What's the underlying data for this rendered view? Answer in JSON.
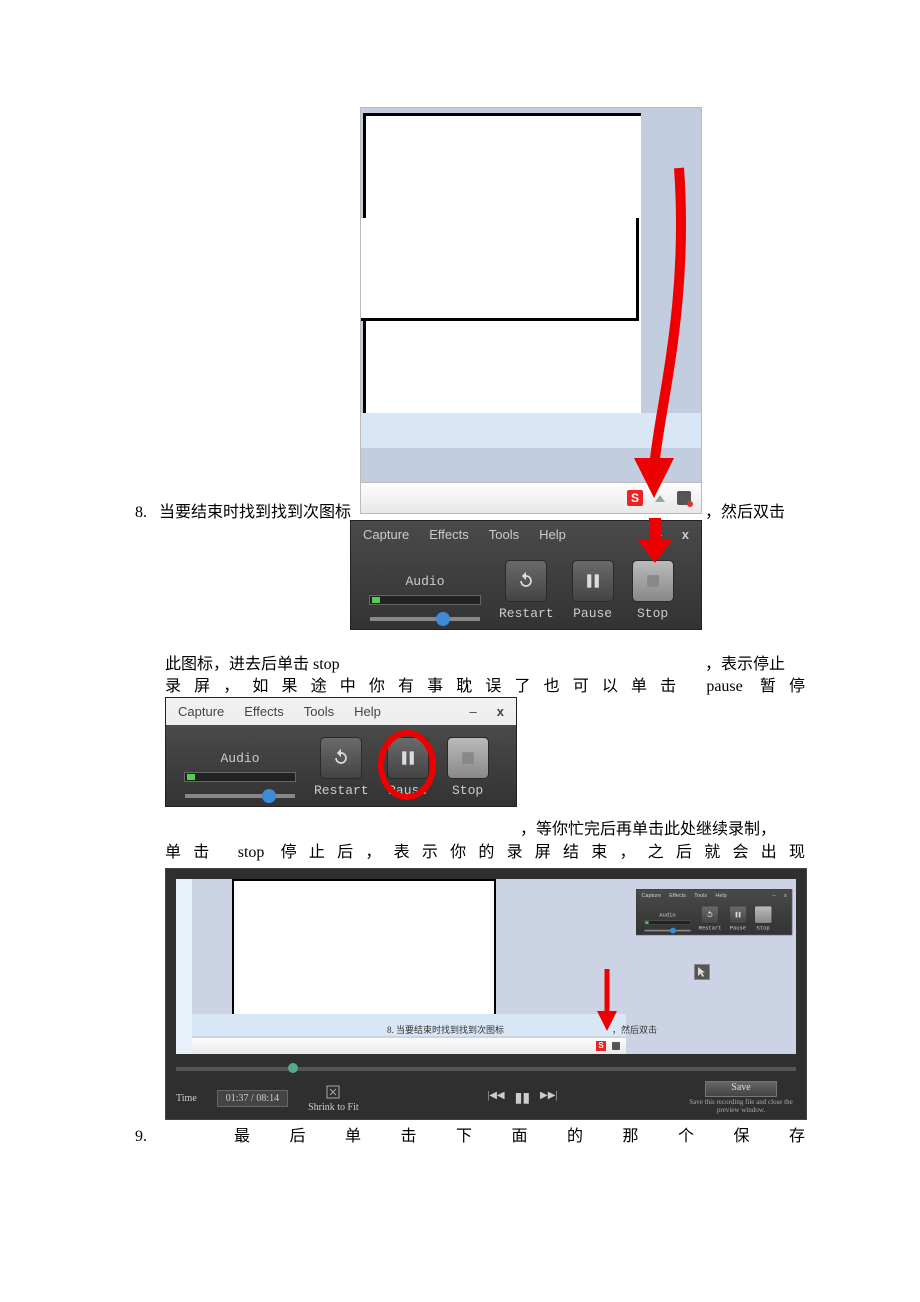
{
  "steps": {
    "s8": {
      "num": "8.",
      "text_a": "当要结束时找到找到次图标",
      "text_b": "，然后双击",
      "text_c": "此图标，进去后单击 stop",
      "text_d": "，表示停止",
      "text_e": "录屏，如果途中你有事耽误了也可以单击 pause  暂停",
      "text_f": "，等你忙完后再单击此处继续录制，",
      "text_g": "单击 stop 停止后，表示你的录屏结束，之后就会出现"
    },
    "s9": {
      "num": "9.",
      "text": "最后单击下面的那个保存"
    }
  },
  "toolbar": {
    "menus": {
      "capture": "Capture",
      "effects": "Effects",
      "tools": "Tools",
      "help": "Help"
    },
    "audio": "Audio",
    "buttons": {
      "restart": "Restart",
      "pause": "Pause",
      "stop": "Stop"
    }
  },
  "player": {
    "time_label": "Time",
    "time_value": "01:37 / 08:14",
    "shrink": "Shrink to Fit",
    "save": "Save",
    "save_tip": "Save this recording file and close the preview window.",
    "inner_text": "8.  当要结束时找到找到次图标",
    "inner_text2": "，然后双击"
  },
  "tray": {
    "s_label": "S"
  }
}
